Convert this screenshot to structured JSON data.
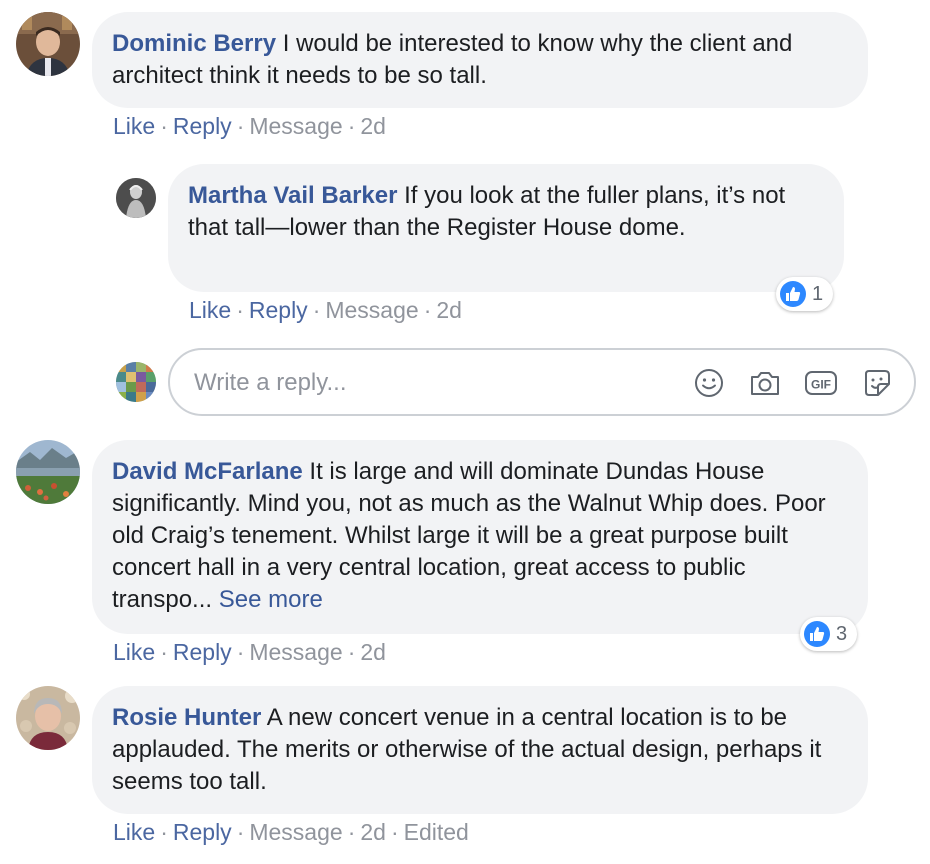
{
  "comments": [
    {
      "author": "Dominic Berry",
      "text": "I would be interested to know why the client and architect think it needs to be so tall.",
      "actions": {
        "like": "Like",
        "reply": "Reply",
        "message": "Message",
        "time": "2d"
      }
    },
    {
      "author": "Martha Vail Barker",
      "text": "If you look at the fuller plans, it’s not that tall—lower than the Register House dome.",
      "actions": {
        "like": "Like",
        "reply": "Reply",
        "message": "Message",
        "time": "2d"
      },
      "reactions": {
        "icon": "like-icon",
        "count": "1"
      }
    },
    {
      "author": "David McFarlane",
      "text": "It is large and will dominate Dundas House significantly. Mind you, not as much as the Walnut Whip does. Poor old Craig’s tenement. Whilst large it will be a great purpose built concert hall in a very central location, great access to public transpo...",
      "see_more": "See more",
      "actions": {
        "like": "Like",
        "reply": "Reply",
        "message": "Message",
        "time": "2d"
      },
      "reactions": {
        "icon": "like-icon",
        "count": "3"
      }
    },
    {
      "author": "Rosie Hunter",
      "text": "A new concert venue in a central location is to be applauded. The merits or otherwise of the actual design, perhaps it seems too tall.",
      "actions": {
        "like": "Like",
        "reply": "Reply",
        "message": "Message",
        "time": "2d",
        "edited": "Edited"
      }
    }
  ],
  "reply_box": {
    "placeholder": "Write a reply...",
    "icons": [
      "emoji-icon",
      "camera-icon",
      "gif-icon",
      "sticker-icon"
    ],
    "gif_label": "GIF"
  },
  "colors": {
    "author": "#385898",
    "action_link": "#4b67a1",
    "meta": "#90949c",
    "bubble": "#f2f3f5",
    "like_blue": "#2d88ff"
  }
}
